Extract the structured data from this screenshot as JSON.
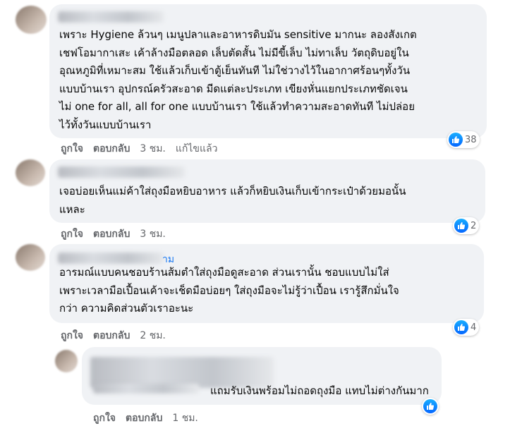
{
  "comments": [
    {
      "text": "เพราะ Hygiene ล้วนๆ เมนูปลาและอาหารดิบมัน sensitive มากนะ ลองสังเกต\nเชฟโอมากาเสะ เค้าล้างมือตลอด เล็บตัดสั้น ไม่มีขี้เล็บ ไม่ทาเล็บ วัตถุดิบอยู่ใน\nอุณหภูมิที่เหมาะสม ใช้แล้วเก็บเข้าตู้เย็นทันที ไม่ใช่วางไว้ในอากาศร้อนๆทั้งวัน\nแบบบ้านเรา อุปกรณ์ครัวสะอาด มีดแต่ละประเภท เขียงหั่นแยกประเภทชัดเจน\nไม่ one for all, all for one แบบบ้านเรา ใช้แล้วทำความสะอาดทันที ไม่ปล่อย\nไว้ทั้งวันแบบบ้านเรา",
      "like_label": "ถูกใจ",
      "reply_label": "ตอบกลับ",
      "time": "3 ชม.",
      "edited": "แก้ไขแล้ว",
      "reactions": "38"
    },
    {
      "text": "เจอบ่อยเห็นแม่ค้าใส่ถุงมือหยิบอาหาร แล้วก็หยิบเงินเก็บเข้ากระเป๋าด้วยมอนั้น\nแหละ",
      "like_label": "ถูกใจ",
      "reply_label": "ตอบกลับ",
      "time": "3 ชม.",
      "reactions": "2"
    },
    {
      "name_tail": "าม",
      "text": "อารมณ์แบบคนชอบร้านส้มตำใส่ถุงมือดูสะอาด ส่วนเรานั้น ชอบแบบไม่ใส่\nเพราะเวลามือเปื้อนเค้าจะเช็ดมือบ่อยๆ ใส่ถุงมือจะไม่รู้ว่าเปื้อน เรารู้สึกมั่นใจ\nกว่า ความคิดส่วนตัวเราอะนะ",
      "like_label": "ถูกใจ",
      "reply_label": "ตอบกลับ",
      "time": "2 ชม.",
      "reactions": "4"
    },
    {
      "text": "แถมรับเงินพร้อมไม่ถอดถุงมือ แทบไม่ต่างกันมาก",
      "like_label": "ถูกใจ",
      "reply_label": "ตอบกลับ",
      "time": "1 ชม."
    }
  ],
  "colors": {
    "bubble": "#f0f2f5",
    "meta_text": "#65676b",
    "like_blue": "#1877f2"
  },
  "icons": [
    "like-icon",
    "avatar"
  ]
}
